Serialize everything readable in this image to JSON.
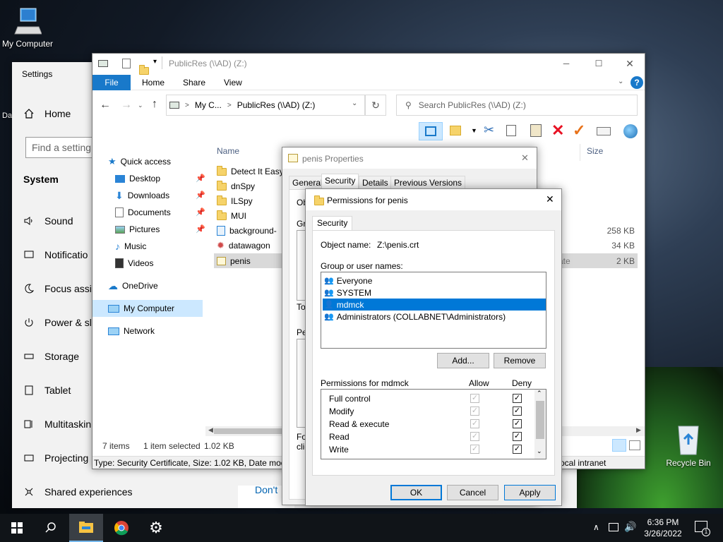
{
  "desktop": {
    "my_computer": "My Computer",
    "recycle_bin": "Recycle Bin",
    "partial_label": "Da"
  },
  "settings": {
    "title": "Settings",
    "home": "Home",
    "search_placeholder": "Find a setting",
    "section": "System",
    "items": [
      "Sound",
      "Notificatio",
      "Focus assis",
      "Power & sl",
      "Storage",
      "Tablet",
      "Multitaskin",
      "Projecting",
      "Shared experiences"
    ],
    "bottom_link": "Don't"
  },
  "explorer": {
    "title": "PublicRes (\\\\AD) (Z:)",
    "ribbon_tabs": [
      "File",
      "Home",
      "Share",
      "View"
    ],
    "address": {
      "part1": "My C...",
      "part2": "PublicRes (\\\\AD) (Z:)"
    },
    "search_placeholder": "Search PublicRes (\\\\AD) (Z:)",
    "nav": {
      "quick_access": "Quick access",
      "desktop": "Desktop",
      "downloads": "Downloads",
      "documents": "Documents",
      "pictures": "Pictures",
      "music": "Music",
      "videos": "Videos",
      "onedrive": "OneDrive",
      "my_computer": "My Computer",
      "network": "Network"
    },
    "columns": {
      "name": "Name",
      "size": "Size"
    },
    "files": [
      {
        "name": "Detect It Easy",
        "size": ""
      },
      {
        "name": "dnSpy",
        "size": ""
      },
      {
        "name": "ILSpy",
        "size": ""
      },
      {
        "name": "MUI",
        "size": ""
      },
      {
        "name": "background-",
        "size": "258 KB"
      },
      {
        "name": "datawagon",
        "size": "34 KB"
      },
      {
        "name": "penis",
        "size": "2 KB",
        "type_partial": "ate"
      }
    ],
    "status": {
      "count": "7 items",
      "selected": "1 item selected",
      "size": "1.02 KB"
    },
    "details_bar": "Type: Security Certificate, Size: 1.02 KB, Date modifi",
    "zone_partial": "ocal intranet"
  },
  "properties": {
    "title": "penis Properties",
    "tabs": [
      "General",
      "Security",
      "Details",
      "Previous Versions"
    ],
    "partial_labels": [
      "Ob",
      "Gr",
      "To",
      "Pe",
      "Fo",
      "clic"
    ]
  },
  "permissions": {
    "title": "Permissions for penis",
    "tab": "Security",
    "object_label": "Object name:",
    "object_value": "Z:\\penis.crt",
    "group_label": "Group or user names:",
    "users": [
      "Everyone",
      "SYSTEM",
      "mdmck",
      "Administrators (COLLABNET\\Administrators)"
    ],
    "selected_user": "mdmck",
    "add_button": "Add...",
    "remove_button": "Remove",
    "perm_header": "Permissions for mdmck",
    "allow": "Allow",
    "deny": "Deny",
    "perms": [
      {
        "name": "Full control",
        "allow": true,
        "deny": true
      },
      {
        "name": "Modify",
        "allow": true,
        "deny": true
      },
      {
        "name": "Read & execute",
        "allow": true,
        "deny": true
      },
      {
        "name": "Read",
        "allow": true,
        "deny": true
      },
      {
        "name": "Write",
        "allow": true,
        "deny": true
      }
    ],
    "ok": "OK",
    "cancel": "Cancel",
    "apply": "Apply"
  },
  "taskbar": {
    "time": "6:36 PM",
    "date": "3/26/2022",
    "notification_count": "1"
  },
  "colors": {
    "selection": "#0078d7",
    "explorer_selected_row": "#cce8ff",
    "deny_red": "#e81123"
  }
}
